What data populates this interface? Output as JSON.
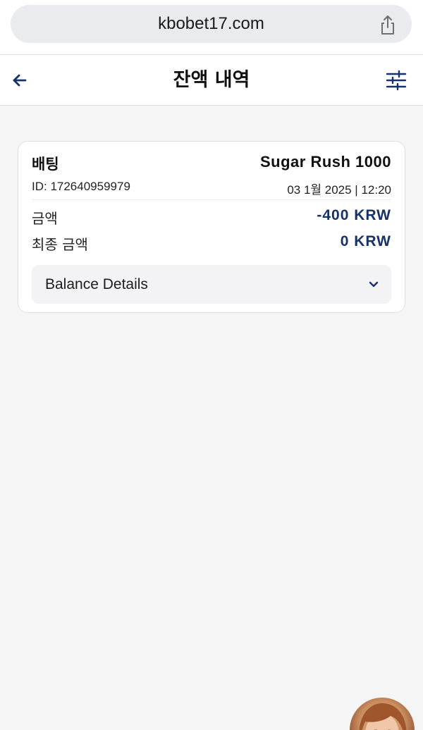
{
  "browser": {
    "url": "kbobet17.com",
    "share_icon": "share-icon"
  },
  "header": {
    "title": "잔액 내역",
    "back_icon": "back-arrow-icon",
    "filter_icon": "filter-sliders-icon"
  },
  "transaction": {
    "type": "배팅",
    "game": "Sugar Rush 1000",
    "id_label": "ID: 172640959979",
    "datetime": "03 1월 2025 | 12:20",
    "amount_label": "금액",
    "amount_value": "-400 KRW",
    "final_label": "최종 금액",
    "final_value": "0 KRW",
    "details_label": "Balance Details",
    "details_icon": "chevron-down-icon"
  },
  "colors": {
    "accent": "#17326a",
    "background": "#f5f5f6"
  }
}
